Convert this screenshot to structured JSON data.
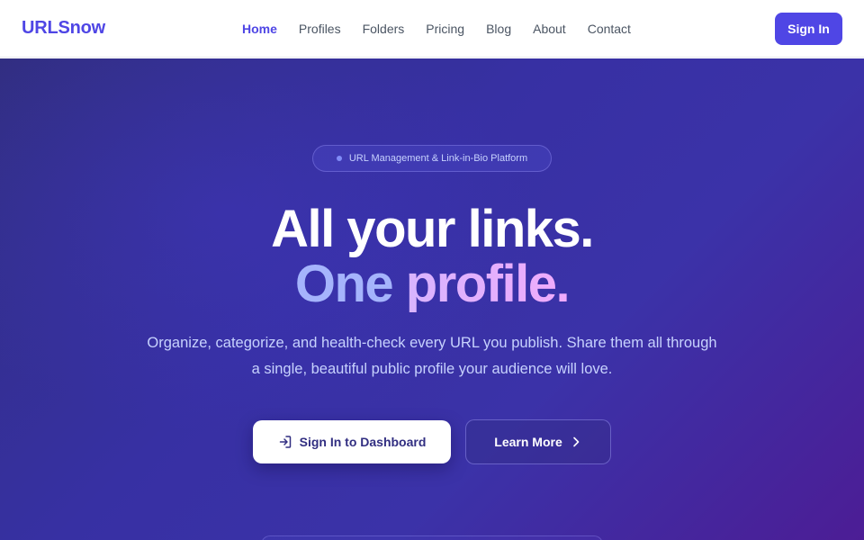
{
  "brand": {
    "name": "URLSnow",
    "color": "#4f46e5"
  },
  "nav": {
    "items": [
      {
        "label": "Home",
        "active": true
      },
      {
        "label": "Profiles",
        "active": false
      },
      {
        "label": "Folders",
        "active": false
      },
      {
        "label": "Pricing",
        "active": false
      },
      {
        "label": "Blog",
        "active": false
      },
      {
        "label": "About",
        "active": false
      },
      {
        "label": "Contact",
        "active": false
      }
    ],
    "signin_label": "Sign In"
  },
  "hero": {
    "pill_text": "URL Management & Link-in-Bio Platform",
    "headline": "All your links.",
    "subline_part1": "One ",
    "subline_part2": "profile.",
    "description": "Organize, categorize, and health-check every URL you publish. Share them all through a single, beautiful public profile your audience will love.",
    "primary_cta": {
      "label": "Sign In to Dashboard",
      "icon": "login-icon"
    },
    "secondary_cta": {
      "label": "Learn More",
      "icon": "chevron-right-icon"
    }
  },
  "colors": {
    "accent": "#4f46e5",
    "hero_gradient_start": "#312e81",
    "hero_gradient_end": "#4c1d95"
  }
}
